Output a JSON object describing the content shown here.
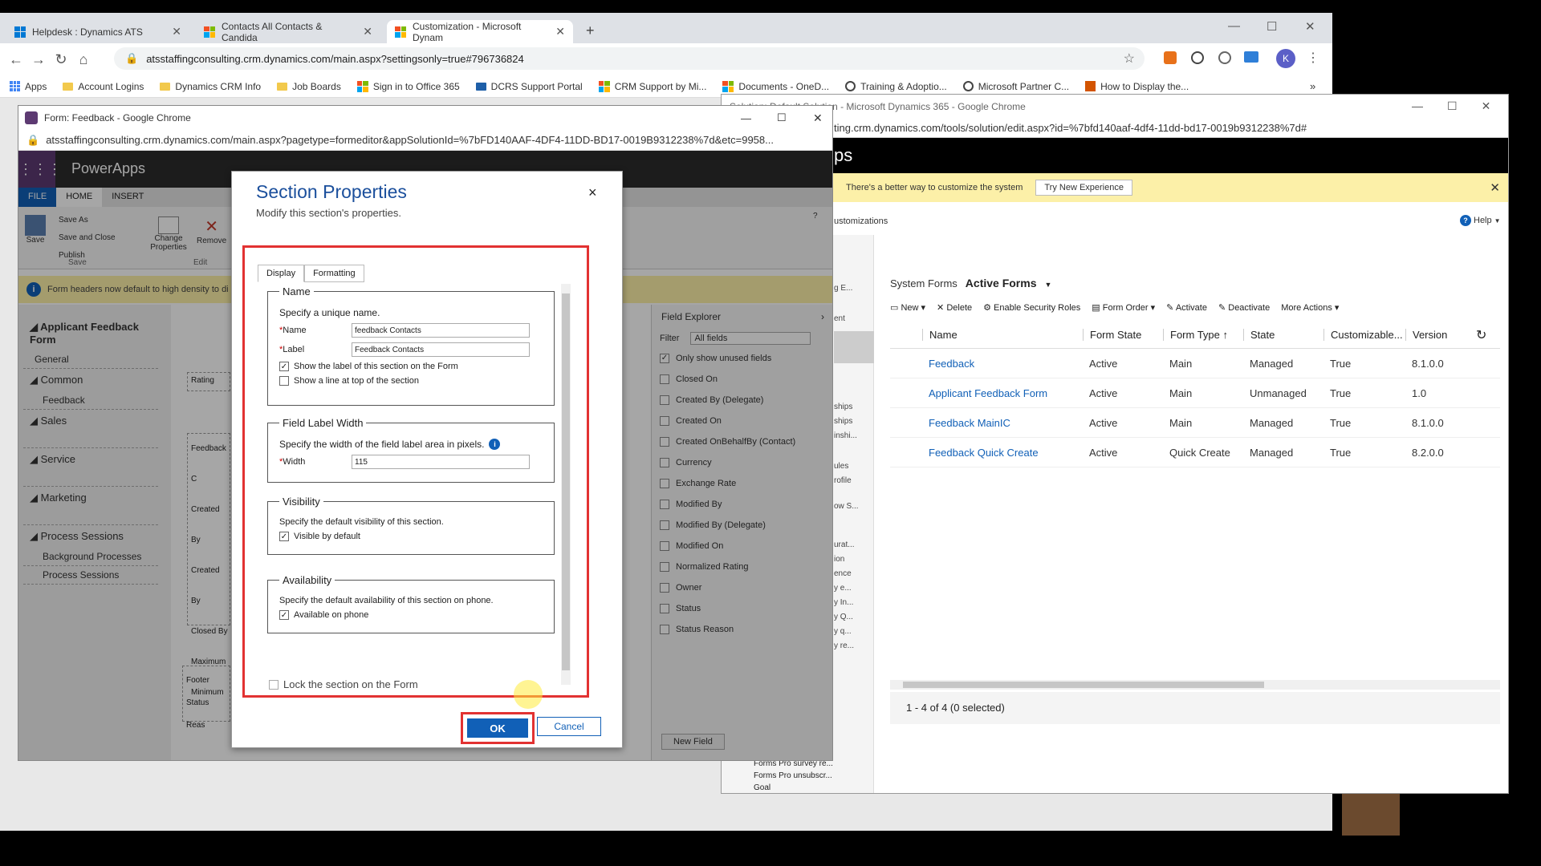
{
  "browser": {
    "tabs": [
      {
        "label": "Helpdesk : Dynamics ATS"
      },
      {
        "label": "Contacts All Contacts & Candida"
      },
      {
        "label": "Customization - Microsoft Dynam"
      }
    ],
    "new_tab": "+",
    "url": "atsstaffingconsulting.crm.dynamics.com/main.aspx?settingsonly=true#796736824",
    "bookmarks": [
      "Apps",
      "Account Logins",
      "Dynamics CRM Info",
      "Job Boards",
      "Sign in to Office 365",
      "DCRS Support Portal",
      "CRM Support by Mi...",
      "Documents - OneD...",
      "Training & Adoptio...",
      "Microsoft Partner C...",
      "How to Display the..."
    ],
    "bookmarks_more": "»",
    "profile_initial": "K"
  },
  "solution_window": {
    "title": "Solution: Default Solution - Microsoft Dynamics 365 - Google Chrome",
    "url": "ting.crm.dynamics.com/tools/solution/edit.aspx?id=%7bfd140aaf-4df4-11dd-bd17-0019b9312238%7d#",
    "app_fragment": "ps",
    "banner_text": "There's a better way to customize the system",
    "banner_button": "Try New Experience",
    "breadcrumb": "ustomizations",
    "help": "Help",
    "view_label": "System Forms",
    "view_name": "Active Forms",
    "commands": [
      "New",
      "Delete",
      "Enable Security Roles",
      "Form Order",
      "Activate",
      "Deactivate",
      "More Actions"
    ],
    "columns": [
      "Name",
      "Form State",
      "Form Type",
      "State",
      "Customizable...",
      "Version"
    ],
    "rows": [
      {
        "name": "Feedback",
        "state": "Active",
        "type": "Main",
        "managed": "Managed",
        "custom": "True",
        "version": "8.1.0.0"
      },
      {
        "name": "Applicant Feedback Form",
        "state": "Active",
        "type": "Main",
        "managed": "Unmanaged",
        "custom": "True",
        "version": "1.0"
      },
      {
        "name": "Feedback MainIC",
        "state": "Active",
        "type": "Main",
        "managed": "Managed",
        "custom": "True",
        "version": "8.1.0.0"
      },
      {
        "name": "Feedback Quick Create",
        "state": "Active",
        "type": "Quick Create",
        "managed": "Managed",
        "custom": "True",
        "version": "8.2.0.0"
      }
    ],
    "footer": "1 - 4 of 4 (0 selected)",
    "left_fragments": [
      "g E...",
      "ent",
      "ships",
      "ships",
      "inshi...",
      "ules",
      "rofile",
      "ow S...",
      "urat...",
      "ion",
      "ence",
      "y e...",
      "y In...",
      "y Q...",
      "y q...",
      "y re..."
    ],
    "tree_items": [
      "Forms Pro survey re...",
      "Forms Pro unsubscr...",
      "Goal"
    ]
  },
  "form_window": {
    "title": "Form: Feedback - Google Chrome",
    "url": "atsstaffingconsulting.crm.dynamics.com/main.aspx?pagetype=formeditor&appSolutionId=%7bFD140AAF-4DF4-11DD-BD17-0019B9312238%7d&etc=9958...",
    "app_name": "PowerApps",
    "ribbon_tabs": [
      "FILE",
      "HOME",
      "INSERT"
    ],
    "ribbon_buttons": {
      "save": "Save",
      "save_as": "Save As",
      "save_close": "Save and Close",
      "publish": "Publish",
      "change_props": "Change Properties",
      "remove": "Remove",
      "group_save": "Save",
      "group_edit": "Edit"
    },
    "notice": "Form headers now default to high density to di",
    "nav_title": "Applicant Feedback Form",
    "nav_general": "General",
    "nav_common": "Common",
    "nav_feedback": "Feedback",
    "nav_sales": "Sales",
    "nav_service": "Service",
    "nav_marketing": "Marketing",
    "nav_process": "Process Sessions",
    "nav_bg": "Background Processes",
    "nav_ps": "Process Sessions",
    "canvas_items": [
      "Rating",
      "Feedback C",
      "Created By",
      "Created By",
      "Closed By",
      "Maximum",
      "Minimum",
      "Footer",
      "Status Reas"
    ],
    "fe_title": "Field Explorer",
    "fe_filter": "Filter",
    "fe_filter_value": "All fields",
    "fe_only_unused": "Only show unused fields",
    "fe_fields": [
      "Closed On",
      "Created By (Delegate)",
      "Created On",
      "Created OnBehalfBy (Contact)",
      "Currency",
      "Exchange Rate",
      "Modified By",
      "Modified By (Delegate)",
      "Modified On",
      "Normalized Rating",
      "Owner",
      "Status",
      "Status Reason"
    ],
    "fe_new_field": "New Field",
    "window_controls": [
      "—",
      "☐",
      "✕"
    ],
    "side_fragments": [
      "So",
      "Fo"
    ]
  },
  "dialog": {
    "title": "Section Properties",
    "subtitle": "Modify this section's properties.",
    "close": "×",
    "tabs": [
      "Display",
      "Formatting"
    ],
    "name_group": {
      "legend": "Name",
      "hint": "Specify a unique name.",
      "name_label": "Name",
      "name_value": "feedback Contacts",
      "label_label": "Label",
      "label_value": "Feedback Contacts",
      "show_label": "Show the label of this section on the Form",
      "show_line": "Show a line at top of the section"
    },
    "width_group": {
      "legend": "Field Label Width",
      "hint": "Specify the width of the field label area in pixels.",
      "width_label": "Width",
      "width_value": "115"
    },
    "visibility_group": {
      "legend": "Visibility",
      "hint": "Specify the default visibility of this section.",
      "check": "Visible by default"
    },
    "availability_group": {
      "legend": "Availability",
      "hint": "Specify the default availability of this section on phone.",
      "check": "Available on phone"
    },
    "lock": "Lock the section on the Form",
    "ok": "OK",
    "cancel": "Cancel"
  },
  "colors": {
    "accent": "#1160b7",
    "highlight": "#e23232",
    "banner": "#fcf0a8"
  }
}
